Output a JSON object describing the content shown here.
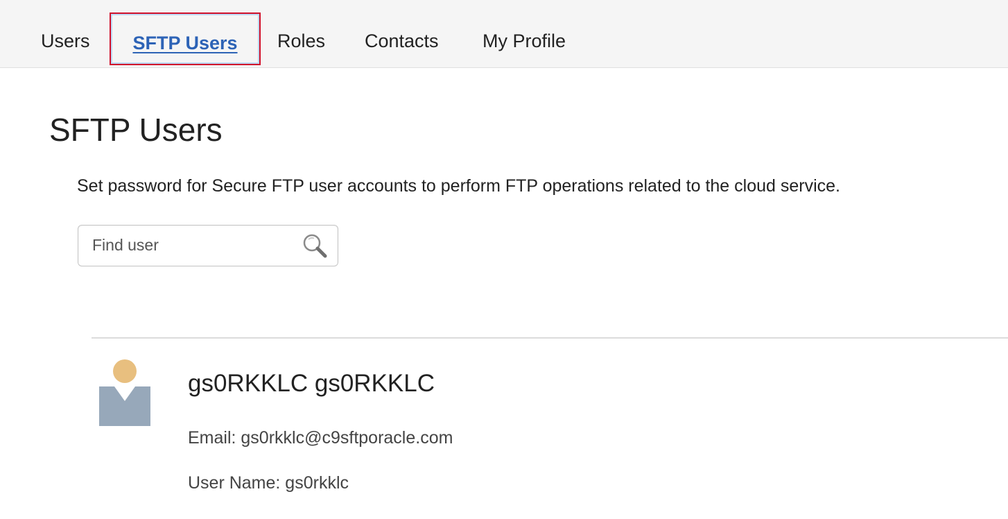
{
  "tabs": {
    "users": "Users",
    "sftp_users": "SFTP Users",
    "roles": "Roles",
    "contacts": "Contacts",
    "my_profile": "My Profile",
    "active": "SFTP Users"
  },
  "page": {
    "title": "SFTP Users",
    "description": "Set password for Secure FTP user accounts to perform FTP operations related to the cloud service."
  },
  "search": {
    "placeholder": "Find user",
    "value": "",
    "icon": "search-icon"
  },
  "user": {
    "display_name": "gs0RKKLC gs0RKKLC",
    "email_line": "Email: gs0rkklc@c9sftporacle.com",
    "username_line": "User Name: gs0rkklc",
    "avatar_icon": "user-avatar-icon"
  },
  "colors": {
    "active_tab_text": "#2d63b6",
    "active_tab_border": "#d0102b",
    "avatar_head": "#e8bf7f",
    "avatar_body": "#97a8ba",
    "tab_bar_bg": "#f5f5f5"
  }
}
